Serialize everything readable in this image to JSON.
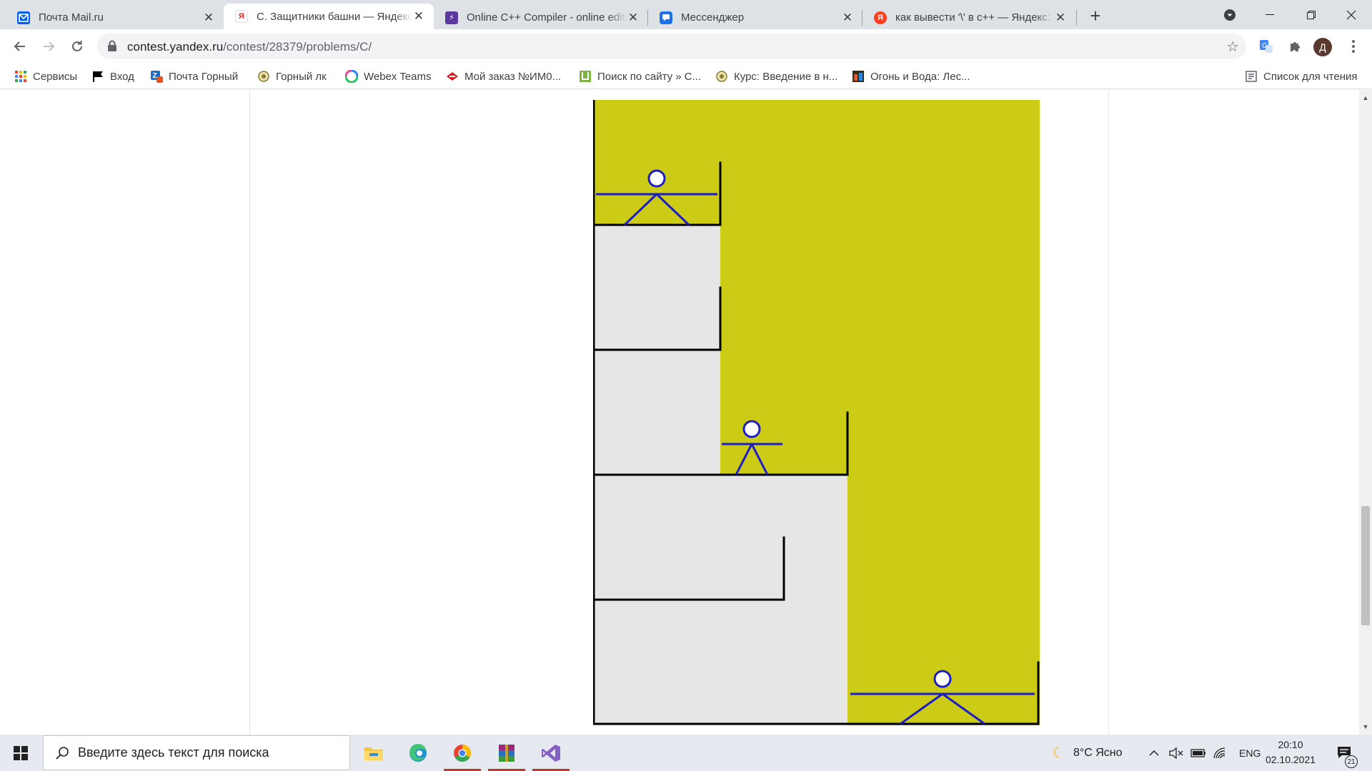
{
  "browser": {
    "tabs": [
      {
        "title": "Почта Mail.ru",
        "favicon": "mail-ru-icon",
        "active": false
      },
      {
        "title": "C. Защитники башни — Яндекс.Контест",
        "favicon": "yandex-contest-icon",
        "active": true
      },
      {
        "title": "Online C++ Compiler - online editor",
        "favicon": "onlinegdb-icon",
        "active": false
      },
      {
        "title": "Мессенджер",
        "favicon": "messenger-icon",
        "active": false
      },
      {
        "title": "как вывести '\\' в c++ — Яндекс: нашлось",
        "favicon": "yandex-icon",
        "active": false
      }
    ],
    "url_host": "contest.yandex.ru",
    "url_path": "/contest/28379/problems/C/",
    "profile_initial": "Д",
    "bookmarks": [
      {
        "label": "Сервисы",
        "icon": "apps-grid-icon"
      },
      {
        "label": "Вход",
        "icon": "flag-icon"
      },
      {
        "label": "Почта Горный",
        "icon": "zimbra-icon"
      },
      {
        "label": "Горный лк",
        "icon": "university-crest-icon"
      },
      {
        "label": "Webex Teams",
        "icon": "webex-icon"
      },
      {
        "label": "Мой заказ №ИМ0...",
        "icon": "spartak-icon"
      },
      {
        "label": "Поиск по сайту » С...",
        "icon": "site-search-icon"
      },
      {
        "label": "Курс: Введение в н...",
        "icon": "university-crest-icon"
      },
      {
        "label": "Огонь и Вода: Лес...",
        "icon": "game-icon"
      }
    ],
    "reading_list_label": "Список для чтения"
  },
  "page": {
    "figure": {
      "colors": {
        "sky": "#cccc17",
        "wall": "#e6e6e6",
        "outline": "#000000",
        "defender": "#1c1cc8"
      },
      "defender_count": 3
    }
  },
  "taskbar": {
    "search_placeholder": "Введите здесь текст для поиска",
    "apps": [
      "file-explorer-icon",
      "edge-icon",
      "chrome-icon",
      "winrar-icon",
      "visual-studio-icon"
    ],
    "weather": "8°C  Ясно",
    "language": "ENG",
    "time": "20:10",
    "date": "02.10.2021",
    "notifications": "21"
  }
}
